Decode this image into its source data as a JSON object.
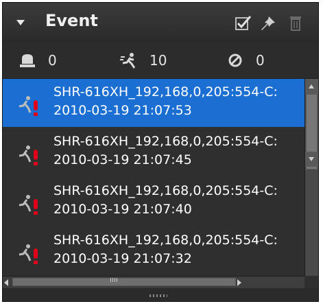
{
  "panel": {
    "title": "Event",
    "header_icons": [
      "acknowledge-icon",
      "pin-icon",
      "delete-icon"
    ]
  },
  "counters": {
    "sensor": {
      "icon": "sensor-icon",
      "value": "0"
    },
    "motion": {
      "icon": "motion-icon",
      "value": "10"
    },
    "video_loss": {
      "icon": "video-loss-icon",
      "value": "0"
    }
  },
  "events": [
    {
      "source": "SHR-616XH_192,168,0,205:554-C:",
      "timestamp": "2010-03-19 21:07:53",
      "selected": true,
      "icon": "motion-alarm-icon"
    },
    {
      "source": "SHR-616XH_192,168,0,205:554-C:",
      "timestamp": "2010-03-19 21:07:45",
      "selected": false,
      "icon": "motion-alarm-icon"
    },
    {
      "source": "SHR-616XH_192,168,0,205:554-C:",
      "timestamp": "2010-03-19 21:07:40",
      "selected": false,
      "icon": "motion-alarm-icon"
    },
    {
      "source": "SHR-616XH_192,168,0,205:554-C:",
      "timestamp": "2010-03-19 21:07:32",
      "selected": false,
      "icon": "motion-alarm-icon"
    }
  ],
  "colors": {
    "panel_bg": "#2f2f2f",
    "selected_row": "#1c6fd2",
    "alarm_red": "#e0001a",
    "text": "#ffffff"
  }
}
